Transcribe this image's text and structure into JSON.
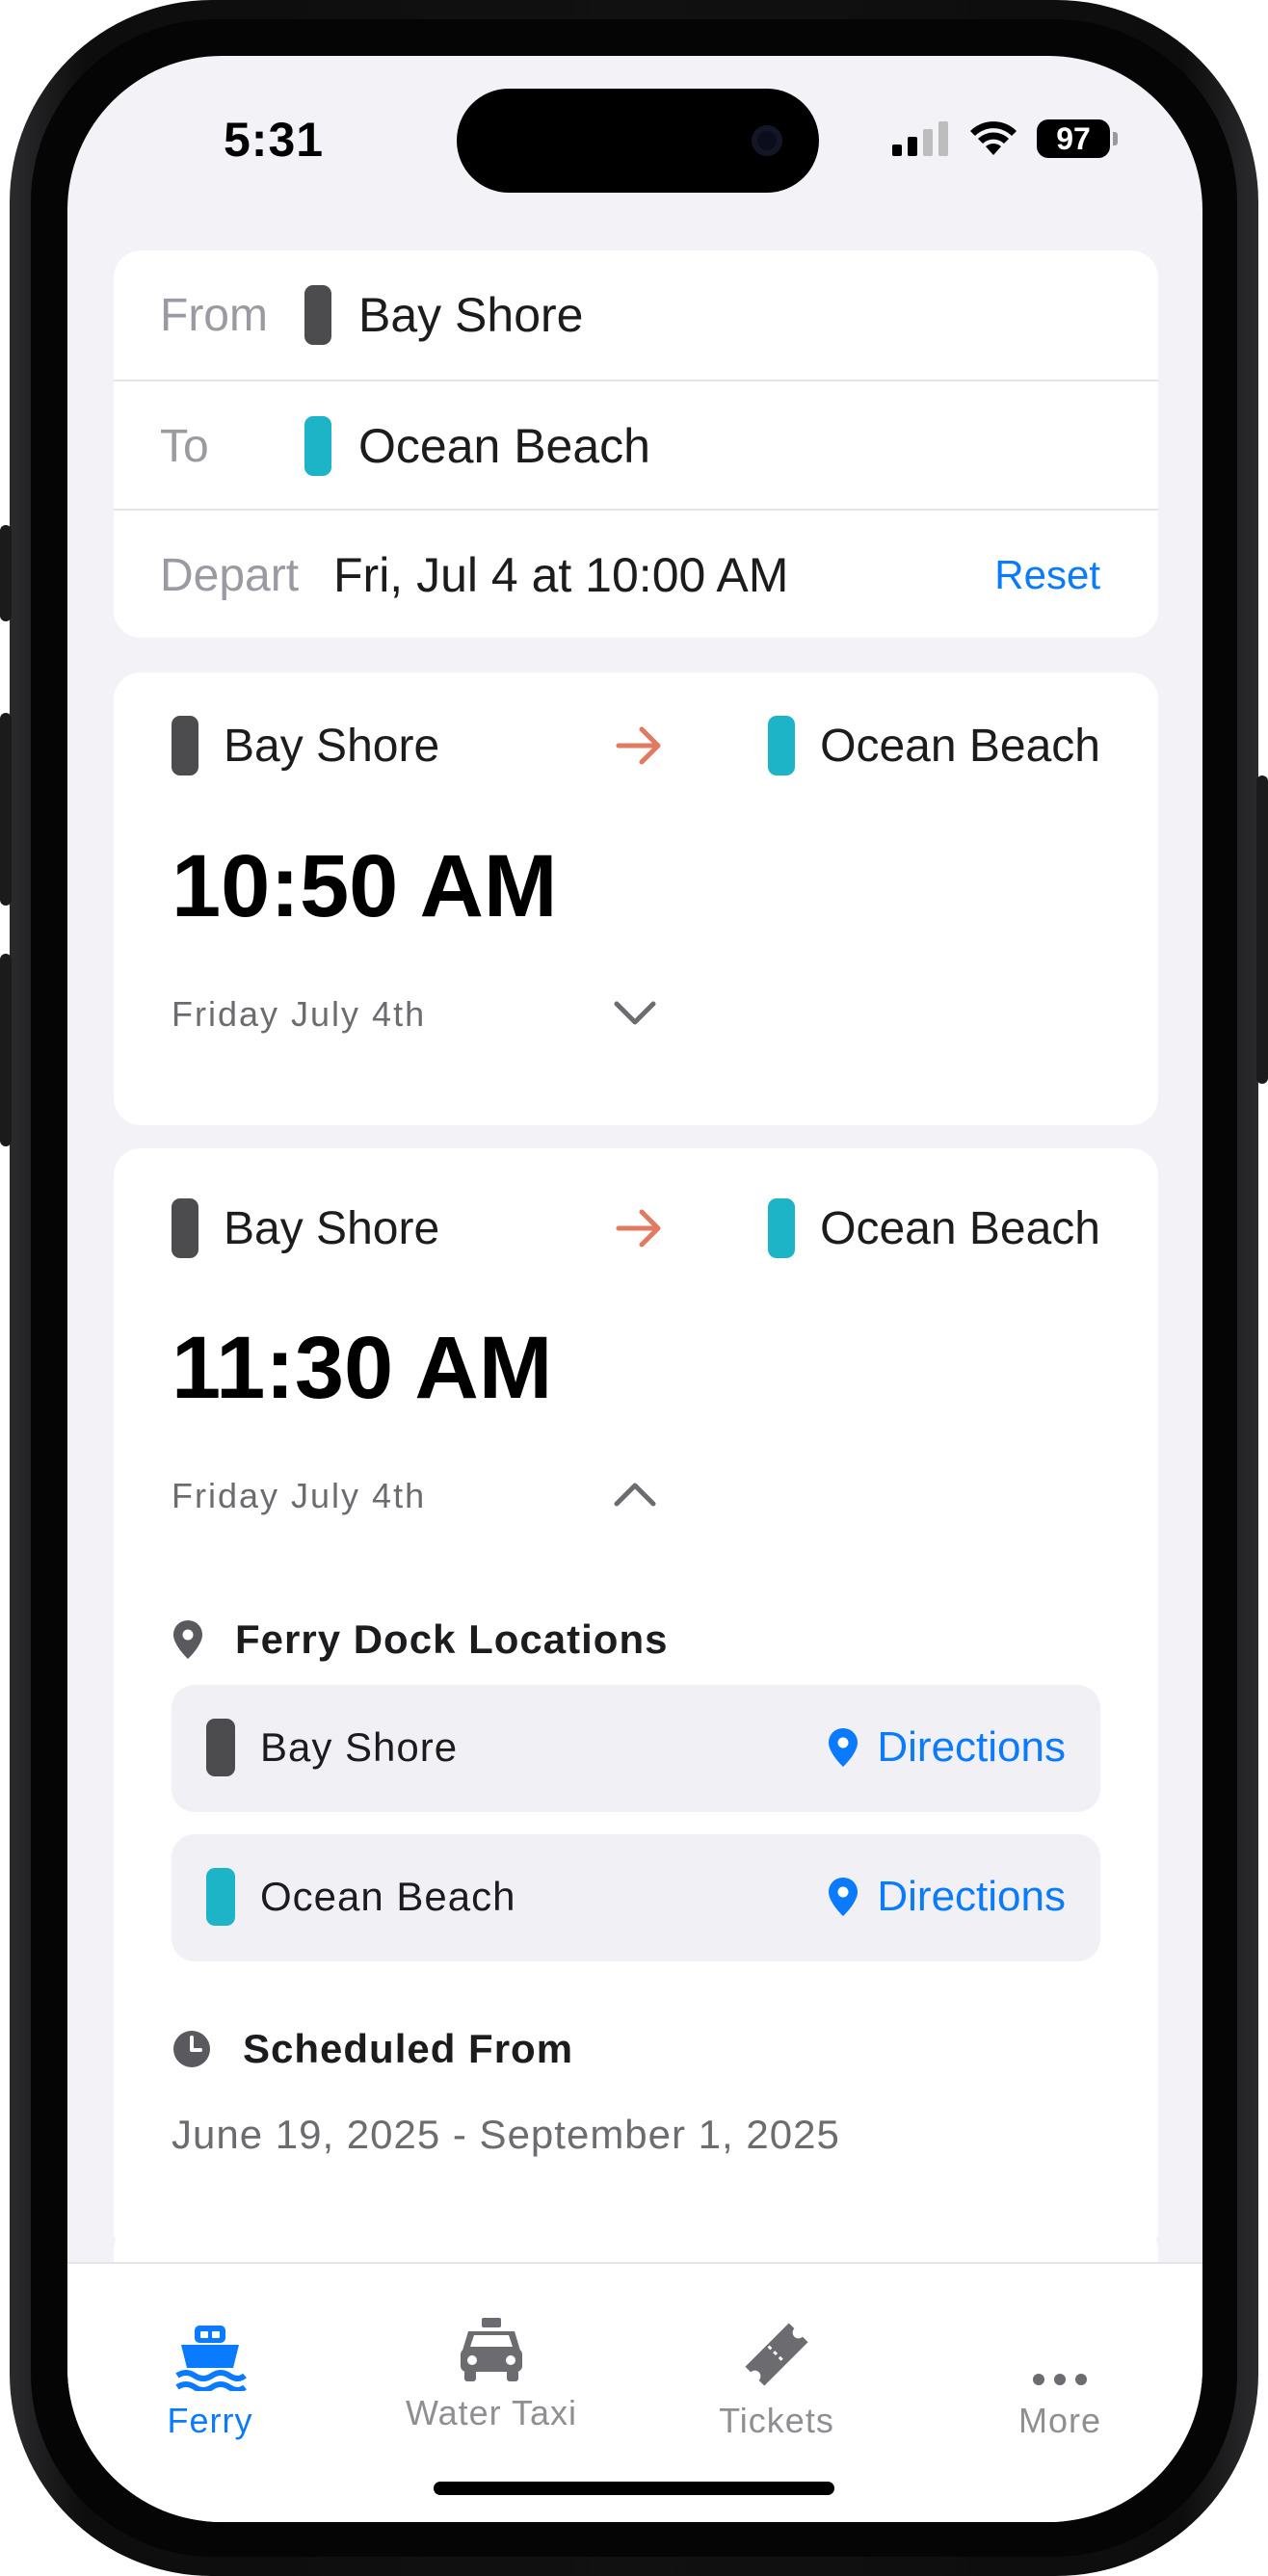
{
  "status": {
    "time": "5:31",
    "battery": "97"
  },
  "search": {
    "from_label": "From",
    "from_value": "Bay Shore",
    "to_label": "To",
    "to_value": "Ocean Beach",
    "depart_label": "Depart",
    "depart_value": "Fri, Jul 4 at 10:00 AM",
    "reset_label": "Reset"
  },
  "trips": [
    {
      "from": "Bay Shore",
      "to": "Ocean Beach",
      "time": "10:50 AM",
      "date": "Friday July 4th",
      "expanded": false
    },
    {
      "from": "Bay Shore",
      "to": "Ocean Beach",
      "time": "11:30 AM",
      "date": "Friday July 4th",
      "expanded": true,
      "dock_title": "Ferry Dock Locations",
      "docks": [
        {
          "name": "Bay Shore",
          "action": "Directions"
        },
        {
          "name": "Ocean Beach",
          "action": "Directions"
        }
      ],
      "schedule_title": "Scheduled From",
      "schedule_range": "June 19, 2025 - September 1, 2025"
    }
  ],
  "tabs": [
    {
      "label": "Ferry",
      "icon": "ferry-icon",
      "active": true
    },
    {
      "label": "Water Taxi",
      "icon": "taxi-icon",
      "active": false
    },
    {
      "label": "Tickets",
      "icon": "ticket-icon",
      "active": false
    },
    {
      "label": "More",
      "icon": "more-icon",
      "active": false
    }
  ],
  "colors": {
    "accent": "#0a7aff",
    "bay_shore": "#4c4c4f",
    "ocean_beach": "#1db4c8",
    "arrow": "#e07a60"
  }
}
